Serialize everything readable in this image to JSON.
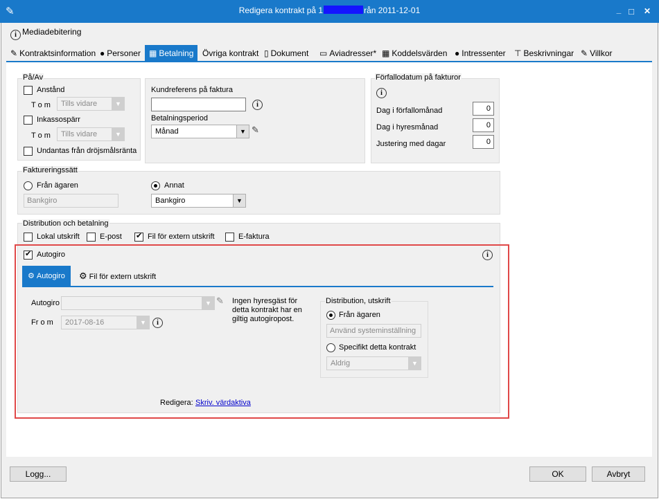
{
  "window": {
    "title_prefix": "Redigera kontrakt på 1",
    "title_suffix": "rån 2011-12-01",
    "minimize": "_",
    "maximize": "□",
    "close": "✕"
  },
  "toolbar": {
    "mediadebitering": "Mediadebitering"
  },
  "tabs": [
    {
      "label": "Kontraktsinformation",
      "icon": "✎"
    },
    {
      "label": "Personer",
      "icon": "●"
    },
    {
      "label": "Betalning",
      "icon": "▦"
    },
    {
      "label": "Övriga kontrakt",
      "icon": ""
    },
    {
      "label": "Dokument",
      "icon": "▯"
    },
    {
      "label": "Aviadresser*",
      "icon": "▭"
    },
    {
      "label": "Koddelsvärden",
      "icon": "▦"
    },
    {
      "label": "Intressenter",
      "icon": "●"
    },
    {
      "label": "Beskrivningar",
      "icon": "⊤"
    },
    {
      "label": "Villkor",
      "icon": "✎"
    }
  ],
  "pa_av": {
    "title": "På/Av",
    "anstand": "Anstånd",
    "tom_label": "T o m",
    "tom1_value": "Tills vidare",
    "inkassosparr": "Inkassospärr",
    "tom2_value": "Tills vidare",
    "undantas": "Undantas från dröjsmålsränta"
  },
  "kund": {
    "referens_label": "Kundreferens på faktura",
    "referens_value": "",
    "period_label": "Betalningsperiod",
    "period_value": "Månad"
  },
  "forfallo": {
    "title": "Förfallodatum på fakturor",
    "dag_forfallomanad": "Dag i förfallomånad",
    "dag_forfallomanad_value": "0",
    "dag_hyresmanad": "Dag i hyresmånad",
    "dag_hyresmanad_value": "0",
    "justering": "Justering med dagar",
    "justering_value": "0"
  },
  "fakturering": {
    "title": "Faktureringssätt",
    "fran_agaren": "Från ägaren",
    "fran_agaren_value": "Bankgiro",
    "annat": "Annat",
    "annat_value": "Bankgiro"
  },
  "distribution": {
    "title": "Distribution och betalning",
    "lokal": "Lokal utskrift",
    "epost": "E-post",
    "fil": "Fil för extern utskrift",
    "efaktura": "E-faktura",
    "autogiro": "Autogiro"
  },
  "autogiro_tabs": [
    {
      "label": "Autogiro",
      "icon": "⚙"
    },
    {
      "label": "Fil för extern utskrift",
      "icon": "⚙"
    }
  ],
  "autogiro_form": {
    "autogiro_label": "Autogiro",
    "autogiro_value": "",
    "from_label": "Fr o m",
    "from_value": "2017-08-16",
    "message": "Ingen hyresgäst för detta kontrakt har en giltig autogiropost.",
    "redigera_label": "Redigera:",
    "redigera_link": "Skriv. värdaktiva"
  },
  "dist_utskrift": {
    "title": "Distribution, utskrift",
    "fran_agaren": "Från ägaren",
    "system_value": "Använd systeminställning",
    "specifikt": "Specifikt detta kontrakt",
    "specifikt_value": "Aldrig"
  },
  "buttons": {
    "logg": "Logg...",
    "ok": "OK",
    "avbryt": "Avbryt"
  }
}
